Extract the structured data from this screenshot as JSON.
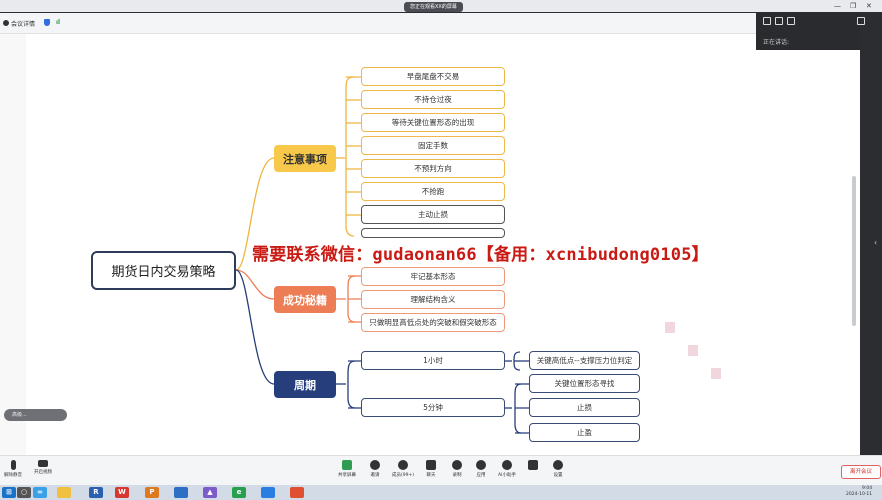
{
  "window": {
    "sharing_notice": "您正在观看XX的屏幕"
  },
  "infobar": {
    "meeting_details": "会议详情",
    "security": "安全",
    "signal": "信号"
  },
  "side_panel": {
    "speaking_label": "正在讲话:"
  },
  "mindmap": {
    "root": "期货日内交易策略",
    "categories": [
      {
        "label": "注意事项",
        "color": "#f7c84a",
        "items": [
          "早盘尾盘不交易",
          "不持仓过夜",
          "等待关键位置形态的出现",
          "固定手数",
          "不预判方向",
          "不抢跑",
          "主动止损"
        ]
      },
      {
        "label": "成功秘籍",
        "color": "#ed7d55",
        "items": [
          "牢记基本形态",
          "理解结构含义",
          "只做明显高低点处的突破和假突破形态"
        ]
      },
      {
        "label": "周期",
        "color": "#263f7c",
        "items": [
          {
            "label": "1小时",
            "children": [
              "关键高低点--支撑压力位判定"
            ]
          },
          {
            "label": "5分钟",
            "children": [
              "关键位置形态寻找",
              "止损",
              "止盈"
            ]
          }
        ]
      }
    ]
  },
  "watermark": "需要联系微信：gudaonan66【备用：xcnibudong0105】",
  "chip_text": "高级...",
  "toolbar": {
    "mute": "解除静音",
    "video": "开启视频",
    "share": "共享屏幕",
    "invite": "邀请",
    "members": "成员(99+)",
    "chat": "聊天",
    "record": "录制",
    "apps": "应用",
    "ai": "AI小助手",
    "settings": "设置",
    "end": "离开会议"
  },
  "taskbar": {
    "time": "9:04",
    "date": "2024-10-11"
  }
}
